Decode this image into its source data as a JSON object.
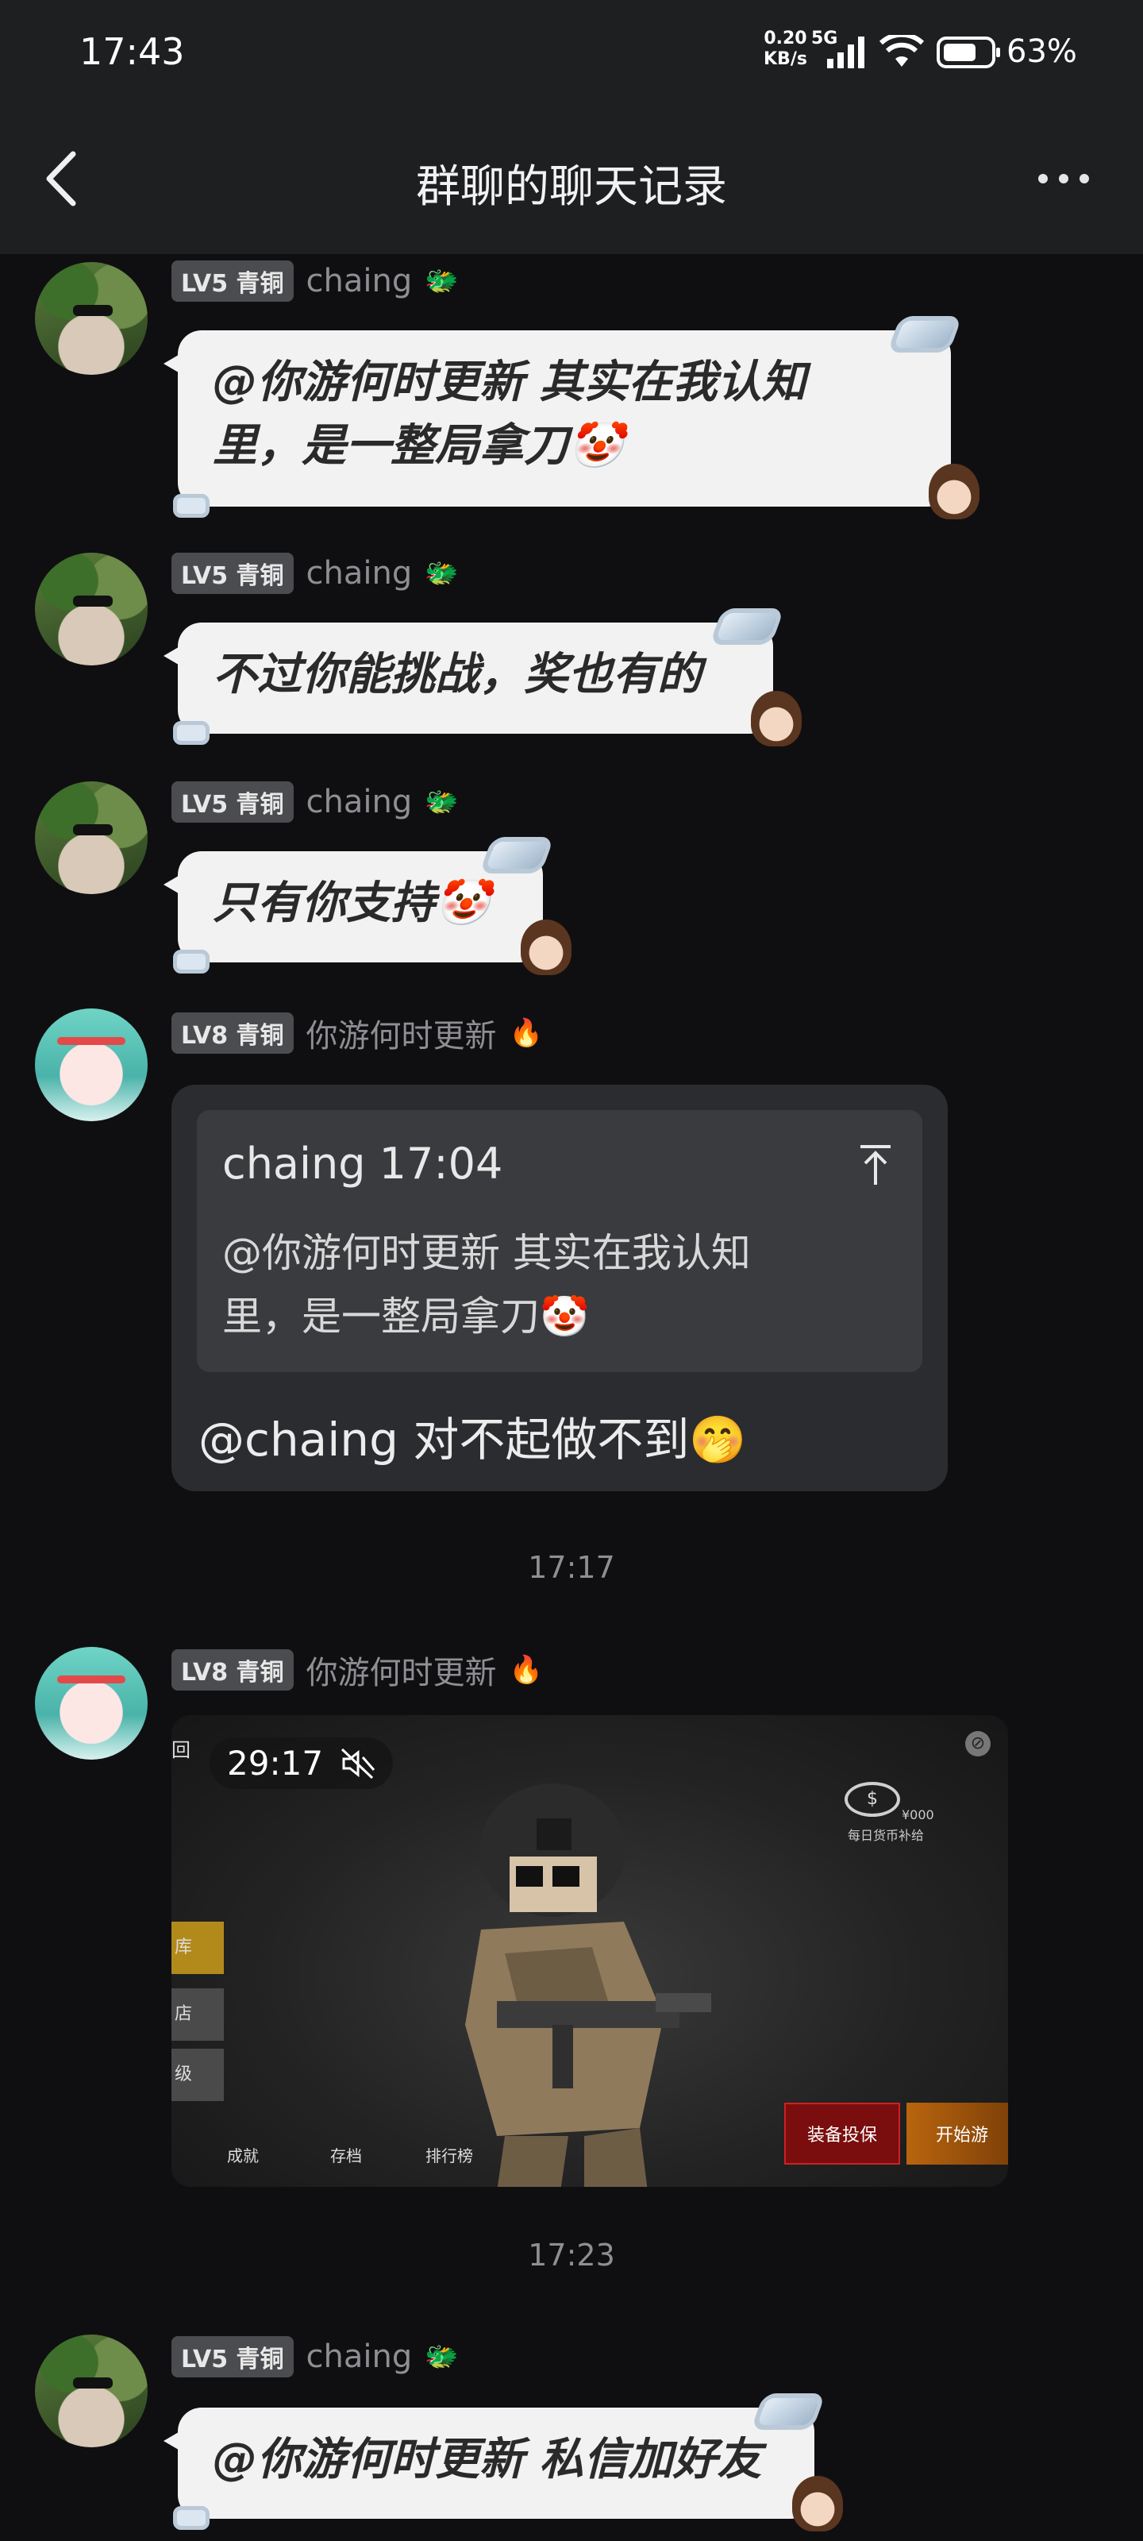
{
  "status_bar": {
    "time": "17:43",
    "net_speed_value": "0.20",
    "net_speed_unit": "KB/s",
    "network_type": "5G",
    "battery_percent": "63%"
  },
  "header": {
    "title": "群聊的聊天记录"
  },
  "messages": [
    {
      "level": "LV5 青铜",
      "user": "chaing",
      "text_line1": "@你游何时更新 其实在我认知",
      "text_line2": "里，是一整局拿刀🤡"
    },
    {
      "level": "LV5 青铜",
      "user": "chaing",
      "text": "不过你能挑战，奖也有的"
    },
    {
      "level": "LV5 青铜",
      "user": "chaing",
      "text": "只有你支持🤡"
    },
    {
      "level": "LV8 青铜",
      "user": "你游何时更新",
      "quote": {
        "header": "chaing 17:04",
        "line1": "@你游何时更新 其实在我认知",
        "line2": "里，是一整局拿刀🤡"
      },
      "reply": "@chaing 对不起做不到🤭"
    },
    {
      "level": "LV8 青铜",
      "user": "你游何时更新"
    },
    {
      "level": "LV5 青铜",
      "user": "chaing",
      "text": "@你游何时更新 私信加好友"
    }
  ],
  "timestamps": [
    "17:17",
    "17:23"
  ],
  "video": {
    "duration": "29:17",
    "corner_label": "回",
    "coin_label": "$",
    "coin_amount": "¥000",
    "coin_caption": "每日货币补给",
    "side_tabs": [
      "库",
      "店",
      "级"
    ],
    "bottom_tabs": [
      "成就",
      "存档",
      "排行榜"
    ],
    "insure_button": "装备投保",
    "start_button": "开始游"
  }
}
